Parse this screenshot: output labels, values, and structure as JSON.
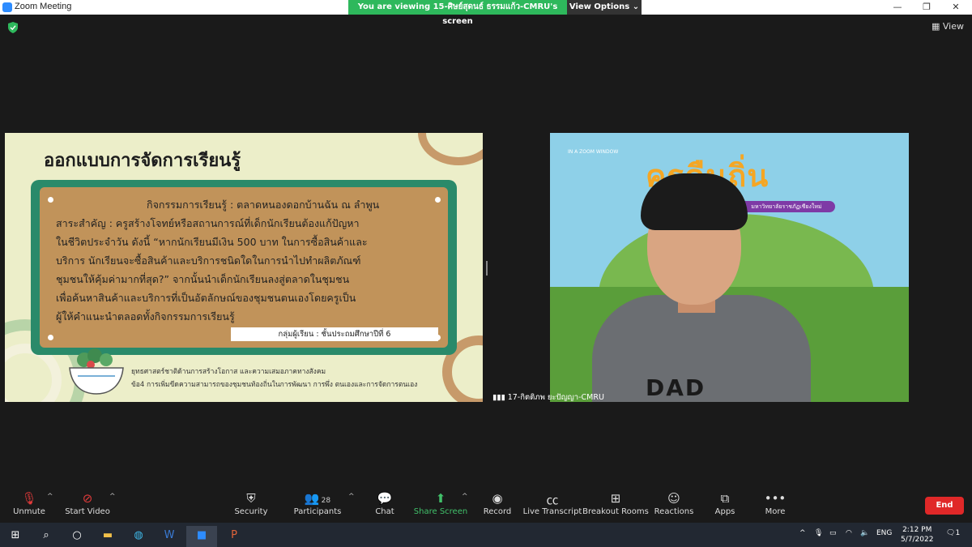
{
  "window": {
    "title": "Zoom Meeting"
  },
  "banner": {
    "viewing_text": "You are viewing 15-ศิษย์สุดนธ์ ธรรมแก้ว-CMRU's screen",
    "view_options": "View Options ⌄"
  },
  "view_button": "View",
  "slide": {
    "title": "ออกแบบการจัดการเรียนรู้",
    "activity_heading": "กิจกรรมการเรียนรู้ : ตลาดหนองดอกบ้านฉัน ณ ลำพูน",
    "body_lines": [
      "สาระสำคัญ : ครูสร้างโจทย์หรือสถานการณ์ที่เด็กนักเรียนต้องแก้ปัญหา",
      "ในชีวิตประจำวัน ดังนี้ “หากนักเรียนมีเงิน 500 บาท ในการซื้อสินค้าและ",
      "บริการ นักเรียนจะซื้อสินค้าและบริการชนิดใดในการนำไปทำผลิตภัณฑ์",
      "ชุมชนให้คุ้มค่ามากที่สุด?” จากนั้นนำเด็กนักเรียนลงสู่ตลาดในชุมชน",
      "เพื่อค้นหาสินค้าและบริการที่เป็นอัตลักษณ์ของชุมชนตนเองโดยครูเป็น",
      "ผู้ให้คำแนะนำตลอดทั้งกิจกรรมการเรียนรู้"
    ],
    "group": "กลุ่มผู้เรียน : ชั้นประถมศึกษาปีที่ 6",
    "strategy_lines": [
      "ยุทธศาสตร์ชาติด้านการสร้างโอกาส และความเสมอภาคทางสังคม",
      "ข้อ4 การเพิ่มขีดความสามารถของชุมชนท้องถิ่นในการพัฒนา การพึ่ง ตนเองและการจัดการตนเอง"
    ]
  },
  "camera": {
    "background_title": "ครูคืนถิ่น",
    "background_subtitle": "มหาวิทยาลัยราชภัฏเชียงใหม่",
    "small_label": "IN A ZOOM WINDOW",
    "shirt_text": "DAD",
    "participant_name": "17-กิตติภพ ยะปัญญา-CMRU"
  },
  "toolbar": {
    "unmute": "Unmute",
    "start_video": "Start Video",
    "security": "Security",
    "participants": "Participants",
    "participants_count": "28",
    "chat": "Chat",
    "share_screen": "Share Screen",
    "record": "Record",
    "live_transcript": "Live Transcript",
    "breakout_rooms": "Breakout Rooms",
    "reactions": "Reactions",
    "apps": "Apps",
    "more": "More",
    "end": "End"
  },
  "taskbar": {
    "language": "ENG",
    "time": "2:12 PM",
    "date": "5/7/2022",
    "notification_count": "1"
  },
  "colors": {
    "zoom_blue": "#2D8CFF",
    "banner_green": "#2eb85c",
    "end_red": "#e02828",
    "board_green": "#2a8a6a",
    "board_tan": "#c1935a"
  }
}
